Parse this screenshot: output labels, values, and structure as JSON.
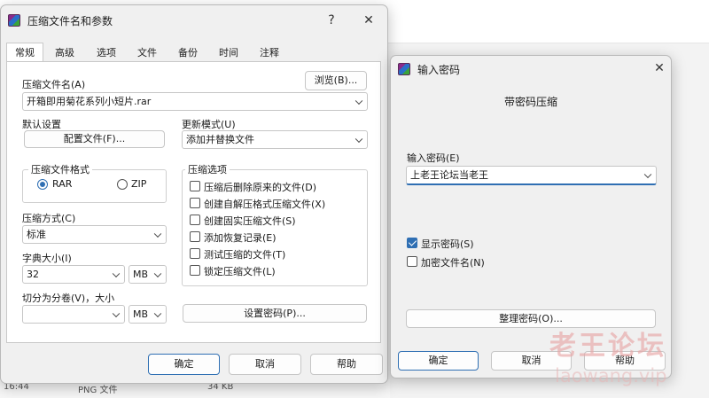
{
  "background": {
    "time": "16:44",
    "type": "PNG 文件",
    "size": "34 KB"
  },
  "main_dialog": {
    "title": "压缩文件名和参数",
    "help_glyph": "?",
    "close_glyph": "✕",
    "tabs": [
      "常规",
      "高级",
      "选项",
      "文件",
      "备份",
      "时间",
      "注释"
    ],
    "archive_name_label": "压缩文件名(A)",
    "browse_button": "浏览(B)...",
    "archive_name_value": "开箱即用菊花系列小短片.rar",
    "default_settings_label": "默认设置",
    "profiles_button": "配置文件(F)...",
    "update_mode_label": "更新模式(U)",
    "update_mode_value": "添加并替换文件",
    "format_group_title": "压缩文件格式",
    "format_rar": "RAR",
    "format_zip": "ZIP",
    "format_selected": "RAR",
    "options_group_title": "压缩选项",
    "options": [
      {
        "label": "压缩后删除原来的文件(D)",
        "checked": false
      },
      {
        "label": "创建自解压格式压缩文件(X)",
        "checked": false
      },
      {
        "label": "创建固实压缩文件(S)",
        "checked": false
      },
      {
        "label": "添加恢复记录(E)",
        "checked": false
      },
      {
        "label": "测试压缩的文件(T)",
        "checked": false
      },
      {
        "label": "锁定压缩文件(L)",
        "checked": false
      }
    ],
    "method_label": "压缩方式(C)",
    "method_value": "标准",
    "dict_label": "字典大小(I)",
    "dict_value": "32",
    "dict_unit": "MB",
    "split_label": "切分为分卷(V)，大小",
    "split_value": "",
    "split_unit": "MB",
    "set_password_button": "设置密码(P)...",
    "ok_button": "确定",
    "cancel_button": "取消",
    "help_button": "帮助"
  },
  "password_dialog": {
    "title": "输入密码",
    "close_glyph": "✕",
    "subtitle": "带密码压缩",
    "password_label": "输入密码(E)",
    "password_value": "上老王论坛当老王",
    "show_password_label": "显示密码(S)",
    "show_password_checked": true,
    "encrypt_names_label": "加密文件名(N)",
    "encrypt_names_checked": false,
    "organize_button": "整理密码(O)...",
    "ok_button": "确定",
    "cancel_button": "取消",
    "help_button": "帮助"
  },
  "watermark": {
    "line1": "老王论坛",
    "line2": "laowang.vip"
  },
  "colors": {
    "accent": "#2f6fb3",
    "dialog_bg": "#f0f0f0",
    "tab_body_bg": "#ffffff",
    "watermark": "#e8a7a7"
  }
}
